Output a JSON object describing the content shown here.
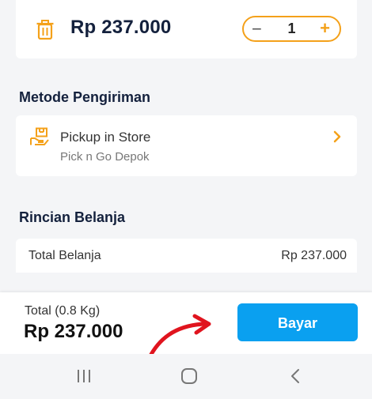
{
  "product": {
    "price": "Rp 237.000",
    "quantity": "1",
    "minus_symbol": "−",
    "plus_symbol": "+",
    "delete_icon": "trash-icon"
  },
  "shipping": {
    "section_title": "Metode Pengiriman",
    "method": "Pickup in Store",
    "store": "Pick n Go Depok",
    "method_icon": "package-box-icon",
    "chevron_icon": "chevron-right-icon"
  },
  "summary": {
    "section_title": "Rincian Belanja",
    "total_label": "Total Belanja",
    "total_value": "Rp 237.000"
  },
  "footer": {
    "weight_label": "Total (0.8 Kg)",
    "total_amount": "Rp 237.000",
    "pay_label": "Bayar"
  },
  "navigation": {
    "recents_icon": "recents-icon",
    "home_icon": "home-icon",
    "back_icon": "back-icon"
  },
  "colors": {
    "accent_orange": "#f4a11a",
    "pay_blue": "#0aa0f0",
    "title_navy": "#14213d",
    "annotation_red": "#e0141e",
    "background": "#f4f5f7"
  }
}
